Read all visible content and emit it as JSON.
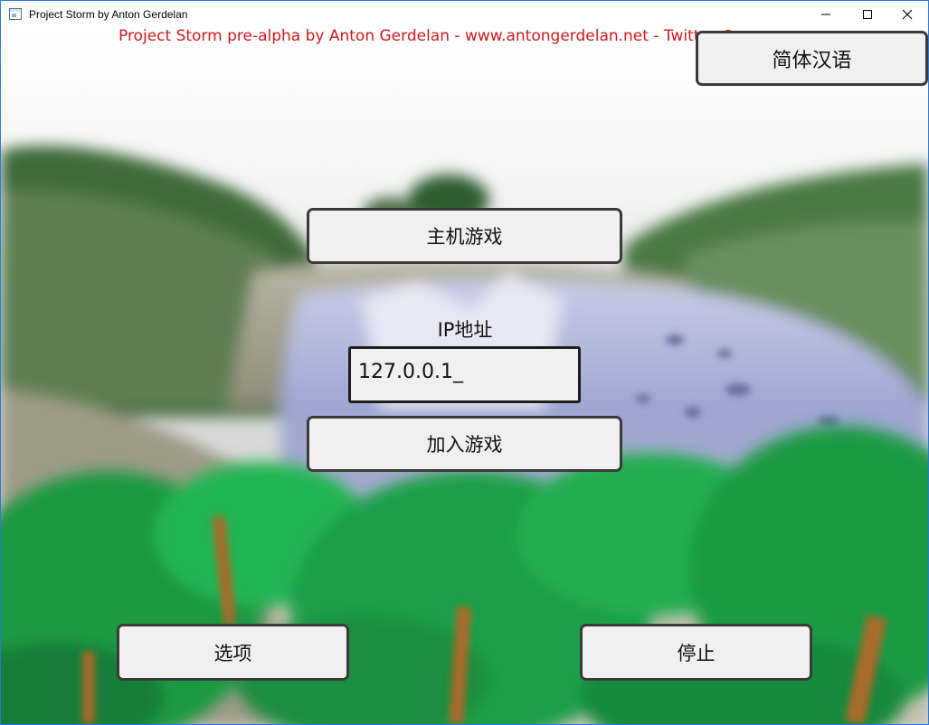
{
  "window": {
    "title": "Project Storm by Anton Gerdelan",
    "icon": "app-window-icon",
    "controls": [
      "minimize-icon",
      "maximize-icon",
      "close-icon"
    ]
  },
  "game": {
    "credits": "Project Storm pre-alpha by Anton Gerdelan - www.antongerdelan.net - Twitter @capnramses",
    "credits_color": "#d11a1a",
    "language_button": "简体汉语",
    "host_button": "主机游戏",
    "ip_label": "IP地址",
    "ip_value": "127.0.0.1_",
    "join_button": "加入游戏",
    "options_button": "选项",
    "quit_button": "停止"
  },
  "colors": {
    "button_bg": "#f0f0f0",
    "button_border": "#3a3a3a",
    "foliage": "#1fa84a",
    "water": "#8e97c9"
  }
}
